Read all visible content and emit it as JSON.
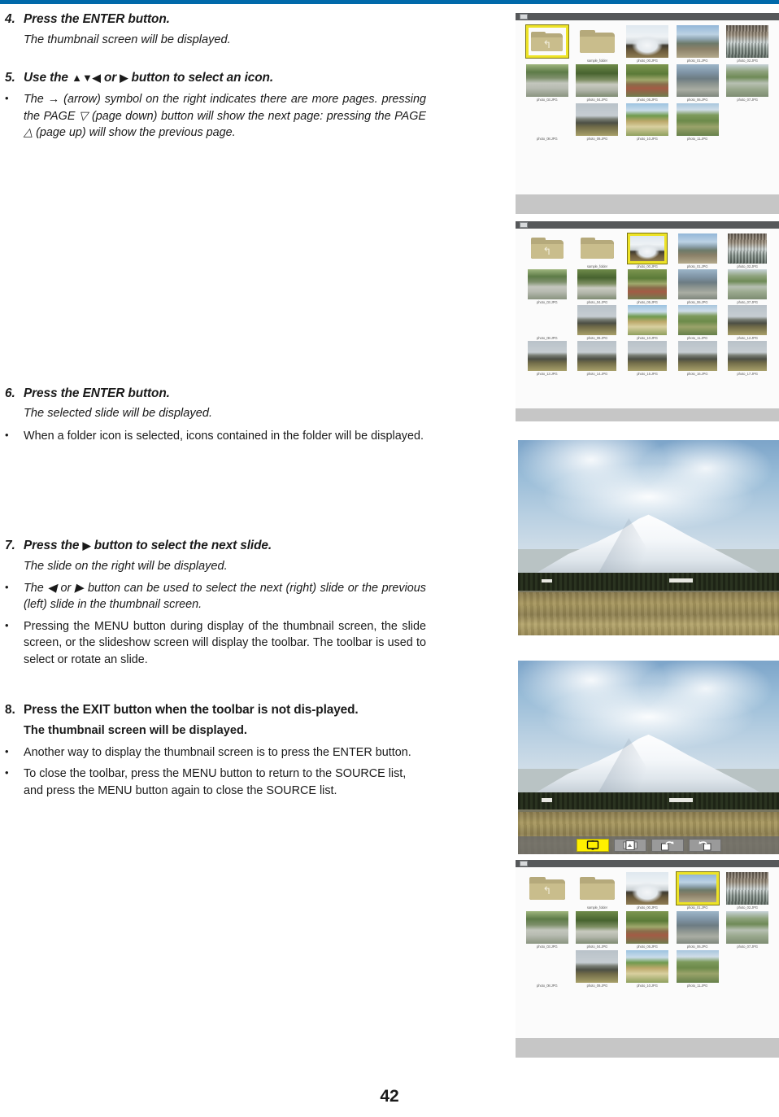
{
  "page": {
    "number": "42",
    "rule_color": "#0069aa"
  },
  "steps": [
    {
      "num": "4.",
      "title": "Press the ENTER button.",
      "sub": "The thumbnail screen will be displayed.",
      "bullets": []
    },
    {
      "num": "5.",
      "title_pre": "Use the ",
      "title_tri1": "▲▼◀",
      "title_mid": " or ",
      "title_tri2": "▶",
      "title_post": " button to select an icon.",
      "bullets": [
        "The → (arrow) symbol on the right indicates there are more pages. pressing the PAGE ▽ (page down) button will show the next page: pressing the PAGE △ (page up) will show the previous page."
      ]
    },
    {
      "num": "6.",
      "title": "Press the ENTER button.",
      "sub": "The selected slide will be displayed.",
      "bullets": [
        "When a folder icon is selected, icons contained in the folder will be displayed."
      ]
    },
    {
      "num": "7.",
      "title_pre": "Press the ",
      "title_tri2": "▶",
      "title_post": " button to select the next slide.",
      "sub": "The slide on the right will be displayed.",
      "bullets": [
        "The ◀ or ▶ button can be used to select the next (right) slide or the previous (left) slide in the thumbnail screen.",
        "Pressing the MENU button during display of the thumbnail screen, the slide screen, or the slideshow screen will display the toolbar. The toolbar is used to select or rotate an slide."
      ]
    },
    {
      "num": "8.",
      "title": "Press the EXIT button when the toolbar is not dis-played.",
      "sub": "The thumbnail screen will be displayed.",
      "bullets": [
        "Another way to display the thumbnail screen is to press the ENTER button.",
        "To close the toolbar, press the MENU button to return to the SOURCE list, and press the MENU button again to close the SOURCE list."
      ]
    }
  ],
  "panels": {
    "thumbnail_top": {
      "title": "thumbnail-screen",
      "selected_index": 0,
      "items": [
        {
          "label": "",
          "kind": "folder-up"
        },
        {
          "label": "sample_folder",
          "kind": "folder"
        },
        {
          "label": "photo_00.JPG",
          "kind": "photo-fuji"
        },
        {
          "label": "photo_01.JPG",
          "kind": "photo-town"
        },
        {
          "label": "photo_02.JPG",
          "kind": "photo-market"
        },
        {
          "label": "photo_03.JPG",
          "kind": "photo-river1"
        },
        {
          "label": "photo_04.JPG",
          "kind": "photo-river2"
        },
        {
          "label": "photo_05.JPG",
          "kind": "photo-village"
        },
        {
          "label": "photo_06.JPG",
          "kind": "photo-city"
        },
        {
          "label": "photo_07.JPG",
          "kind": "photo-canal"
        },
        {
          "label": "photo_08.JPG",
          "kind": "photo-tree"
        },
        {
          "label": "photo_09.JPG",
          "kind": "photo-mtgray"
        },
        {
          "label": "photo_10.JPG",
          "kind": "photo-field1"
        },
        {
          "label": "photo_11.JPG",
          "kind": "photo-field2"
        }
      ]
    },
    "thumbnail_paged": {
      "title": "thumbnail-screen-paged",
      "selected_index": 2,
      "prev_arrow": "←",
      "next_arrow": "→",
      "items": [
        {
          "label": "",
          "kind": "folder-up"
        },
        {
          "label": "sample_folder",
          "kind": "folder"
        },
        {
          "label": "photo_00.JPG",
          "kind": "photo-fuji"
        },
        {
          "label": "photo_01.JPG",
          "kind": "photo-town"
        },
        {
          "label": "photo_02.JPG",
          "kind": "photo-market"
        },
        {
          "label": "photo_03.JPG",
          "kind": "photo-river1"
        },
        {
          "label": "photo_04.JPG",
          "kind": "photo-river2"
        },
        {
          "label": "photo_05.JPG",
          "kind": "photo-village"
        },
        {
          "label": "photo_06.JPG",
          "kind": "photo-city"
        },
        {
          "label": "photo_07.JPG",
          "kind": "photo-canal"
        },
        {
          "label": "photo_08.JPG",
          "kind": "photo-tree"
        },
        {
          "label": "photo_09.JPG",
          "kind": "photo-mtgray"
        },
        {
          "label": "photo_10.JPG",
          "kind": "photo-field1"
        },
        {
          "label": "photo_11.JPG",
          "kind": "photo-field2"
        },
        {
          "label": "photo_12.JPG",
          "kind": "photo-mtgray"
        },
        {
          "label": "photo_13.JPG",
          "kind": "photo-mtgray"
        },
        {
          "label": "photo_14.JPG",
          "kind": "photo-mtgray"
        },
        {
          "label": "photo_15.JPG",
          "kind": "photo-mtgray"
        },
        {
          "label": "photo_16.JPG",
          "kind": "photo-mtgray"
        },
        {
          "label": "photo_17.JPG",
          "kind": "photo-mtgray"
        }
      ]
    },
    "slide_plain": {
      "title": "slide-screen",
      "caption": "snow-capped-mountain-photo"
    },
    "slide_toolbar": {
      "title": "slide-screen-with-toolbar",
      "caption": "snow-capped-mountain-photo",
      "toolbar": [
        {
          "name": "display-slide-button",
          "glyph": "monitor-icon",
          "active": true
        },
        {
          "name": "slideshow-button",
          "glyph": "slideshow-icon",
          "active": false
        },
        {
          "name": "rotate-clockwise-button",
          "glyph": "rotate-cw-icon",
          "active": false
        },
        {
          "name": "rotate-counterclockwise-button",
          "glyph": "rotate-ccw-icon",
          "active": false
        }
      ]
    },
    "thumbnail_bottom": {
      "title": "thumbnail-screen-next-selected",
      "selected_index": 3,
      "items": [
        {
          "label": "",
          "kind": "folder-up"
        },
        {
          "label": "sample_folder",
          "kind": "folder"
        },
        {
          "label": "photo_00.JPG",
          "kind": "photo-fuji"
        },
        {
          "label": "photo_01.JPG",
          "kind": "photo-town"
        },
        {
          "label": "photo_02.JPG",
          "kind": "photo-market"
        },
        {
          "label": "photo_03.JPG",
          "kind": "photo-river1"
        },
        {
          "label": "photo_04.JPG",
          "kind": "photo-river2"
        },
        {
          "label": "photo_05.JPG",
          "kind": "photo-village"
        },
        {
          "label": "photo_06.JPG",
          "kind": "photo-city"
        },
        {
          "label": "photo_07.JPG",
          "kind": "photo-canal"
        },
        {
          "label": "photo_08.JPG",
          "kind": "photo-tree"
        },
        {
          "label": "photo_09.JPG",
          "kind": "photo-mtgray"
        },
        {
          "label": "photo_10.JPG",
          "kind": "photo-field1"
        },
        {
          "label": "photo_11.JPG",
          "kind": "photo-field2"
        }
      ]
    }
  }
}
